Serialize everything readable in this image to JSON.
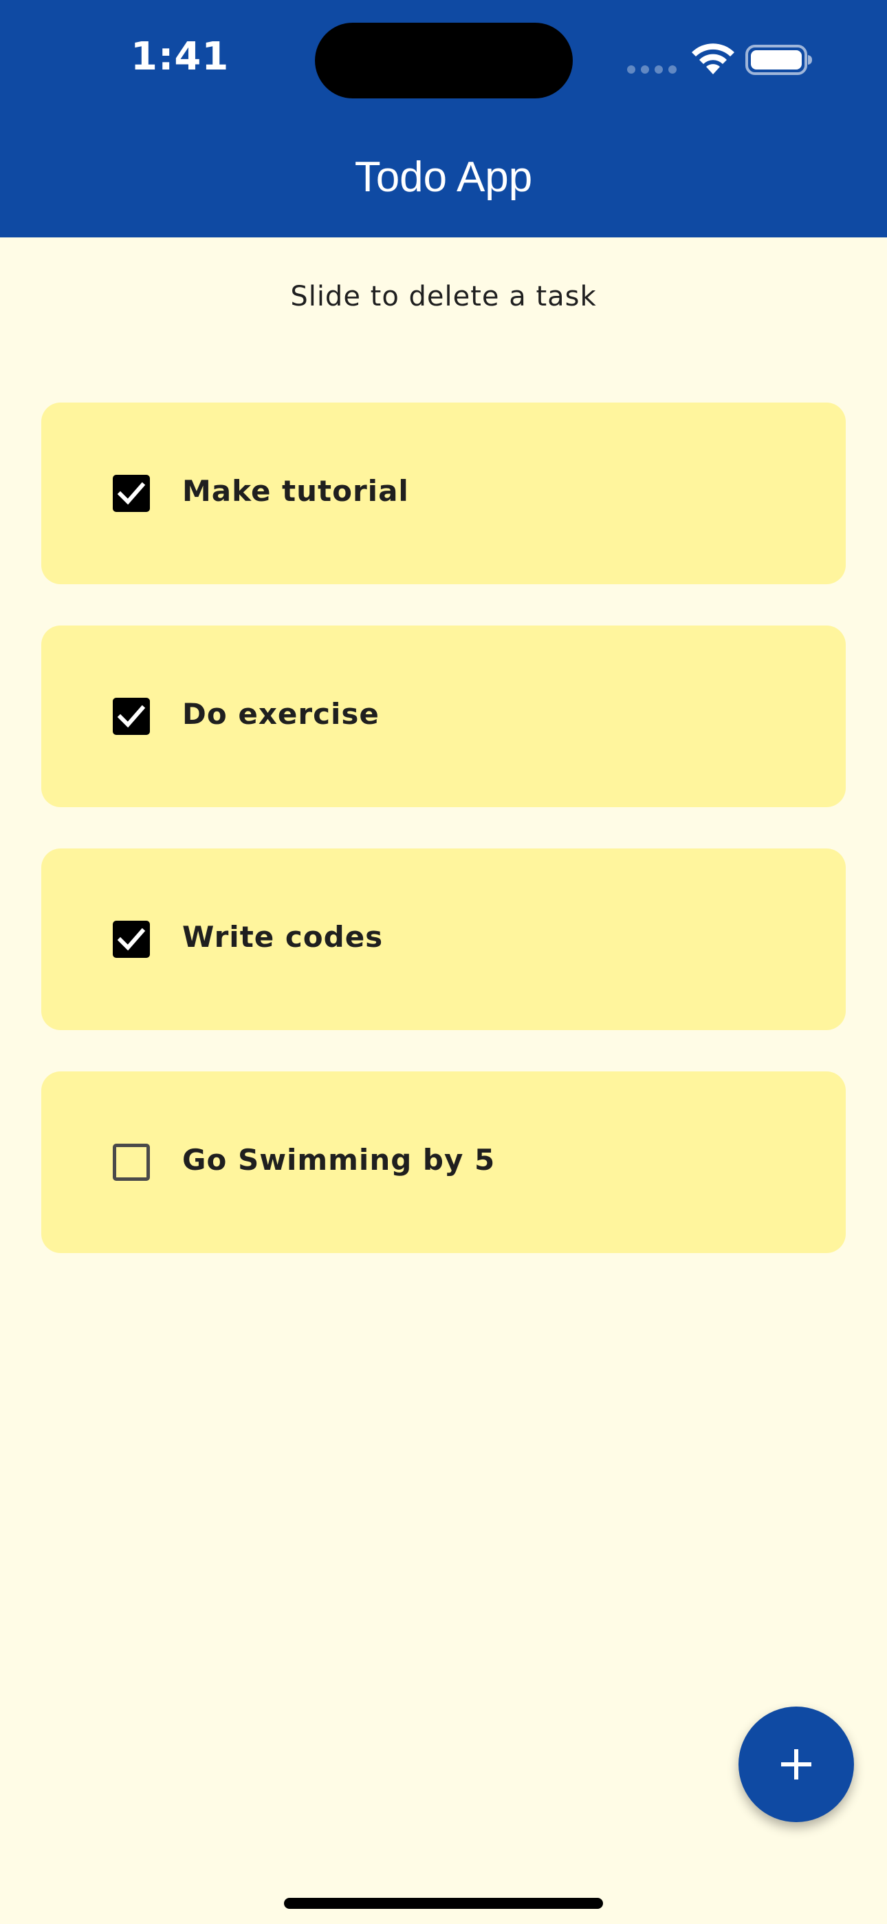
{
  "status_bar": {
    "time": "1:41"
  },
  "header": {
    "title": "Todo App",
    "background": "#0F4AA3"
  },
  "hint": "Slide to delete a task",
  "tasks": [
    {
      "label": "Make tutorial",
      "checked": true
    },
    {
      "label": "Do exercise",
      "checked": true
    },
    {
      "label": "Write codes",
      "checked": true
    },
    {
      "label": "Go Swimming by 5",
      "checked": false
    }
  ],
  "colors": {
    "page_background": "#FFFCE6",
    "card_background": "#FFF59D",
    "accent": "#0F4AA3"
  },
  "icons": {
    "add": "plus-icon",
    "check": "checkmark-icon",
    "wifi": "wifi-icon",
    "battery": "battery-icon",
    "signal": "cellular-signal-icon"
  }
}
